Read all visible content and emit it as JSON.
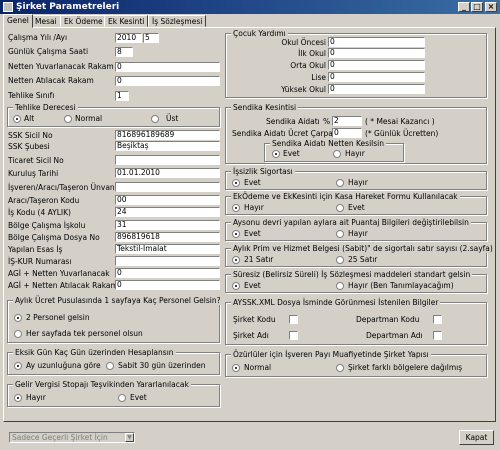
{
  "window": {
    "title": "Şirket Parametreleri"
  },
  "tabs": [
    "Genel",
    "Mesai",
    "Ek Ödeme",
    "Ek Kesinti",
    "İş Sözleşmesi"
  ],
  "left": {
    "yil_label": "Çalışma Yılı /Ayı",
    "yil": "2010",
    "ay": "5",
    "gunluk_label": "Günlük Çalışma Saati",
    "gunluk": "8",
    "yuvarlanacak_label": "Netten Yuvarlanacak Rakam",
    "yuvarlanacak": "0",
    "atilacak_label": "Netten Atılacak Rakam",
    "atilacak": "0",
    "tehlike_sinifi_label": "Tehlike Sınıfı",
    "tehlike_sinifi": "1",
    "tehlike": {
      "title": "Tehlike Derecesi",
      "options": [
        "Alt",
        "Normal",
        "Üst"
      ]
    },
    "fields": [
      {
        "label": "SSK Sicil No",
        "value": "816896189689"
      },
      {
        "label": "SSK Şubesi",
        "value": "Beşiktaş"
      },
      {
        "label": "Ticaret Sicil No",
        "value": ""
      },
      {
        "label": "Kuruluş Tarihi",
        "value": "01.01.2010"
      },
      {
        "label": "İşveren/Aracı/Taşeron Ünvanı",
        "value": ""
      },
      {
        "label": "Aracı/Taşeron Kodu",
        "value": "00"
      },
      {
        "label": "İş Kodu (4 AYLIK)",
        "value": "24"
      },
      {
        "label": "Bölge Çalışma İşkolu",
        "value": "31"
      },
      {
        "label": "Bölge Çalışma Dosya No",
        "value": "896819618"
      },
      {
        "label": "Yapılan Esas İş",
        "value": "Tekstil-İmalat"
      },
      {
        "label": "İŞ-KUR Numarası",
        "value": ""
      },
      {
        "label": "AGİ + Netten Yuvarlanacak",
        "value": "0"
      },
      {
        "label": "AGİ + Netten Atılacak Rakam",
        "value": "0"
      }
    ],
    "pusula": {
      "title": "Aylık Ücret Pusulasında 1 sayfaya Kaç Personel Gelsin?",
      "opt1": "2 Personel gelsin",
      "opt2": "Her sayfada tek personel olsun"
    },
    "eksik": {
      "title": "Eksik Gün Kaç Gün üzerinden Hesaplansın",
      "opt1": "Ay uzunluğuna göre",
      "opt2": "Sabit 30 gün üzerinden"
    },
    "gelir": {
      "title": "Gelir Vergisi Stopajı Teşvikinden Yararlanılacak",
      "opt1": "Hayır",
      "opt2": "Evet"
    }
  },
  "right": {
    "cocuk": {
      "title": "Çocuk Yardımı",
      "rows": [
        {
          "label": "Okul Öncesi",
          "value": "0"
        },
        {
          "label": "İlk Okul",
          "value": "0"
        },
        {
          "label": "Orta Okul",
          "value": "0"
        },
        {
          "label": "Lise",
          "value": "0"
        },
        {
          "label": "Yüksek Okul",
          "value": "0"
        }
      ]
    },
    "sendika": {
      "title": "Sendika Kesintisi",
      "aidati_label": "Sendika Aidatı",
      "pct": "%",
      "aidati": "2",
      "aidati_note": "( * Mesai Kazancı   )",
      "carpani_label": "Sendika Aidatı Ücret Çarpanı",
      "carpani": "0",
      "carpani_note": "(* Günlük Ücretten)",
      "netten": {
        "title": "Sendika Aidatı Netten Kesilsin",
        "opt1": "Evet",
        "opt2": "Hayır"
      }
    },
    "issizlik": {
      "title": "İşsizlik Sigortası",
      "opt1": "Evet",
      "opt2": "Hayır"
    },
    "ekodeme": {
      "title": "EkÖdeme ve EkKesinti için Kasa Hareket Formu Kullanılacak",
      "opt1": "Hayır",
      "opt2": "Evet"
    },
    "aysonu": {
      "title": "Aysonu devri yapılan aylara ait Puantaj Bilgileri değiştirilebilsin",
      "opt1": "Evet",
      "opt2": "Hayır"
    },
    "prim": {
      "title": "Aylık Prim ve Hizmet Belgesi (Sabit)\" de sigortalı satır sayısı (2.sayfa)",
      "opt1": "21 Satır",
      "opt2": "25 Satır"
    },
    "suresiz": {
      "title": "Süresiz (Belirsiz Süreli) İş Sözleşmesi maddeleri standart gelsin",
      "opt1": "Evet",
      "opt2": "Hayır (Ben Tanımlayacağım)"
    },
    "ayssk": {
      "title": "AYSSK.XML Dosya İsminde Görünmesi İstenilen Bilgiler",
      "sirket_kodu": "Şirket Kodu",
      "sirket_adi": "Şirket Adı",
      "departman_kodu": "Departman Kodu",
      "departman_adi": "Departman Adı"
    },
    "ozurluler": {
      "title": "Özürlüler için İşveren Payı Muafiyetinde Şirket Yapısı",
      "opt1": "Normal",
      "opt2": "Şirket farklı bölgelere dağılmış"
    }
  },
  "footer": {
    "select_value": "Sadece Geçerli Şirket İçin",
    "close_button": "Kapat"
  }
}
